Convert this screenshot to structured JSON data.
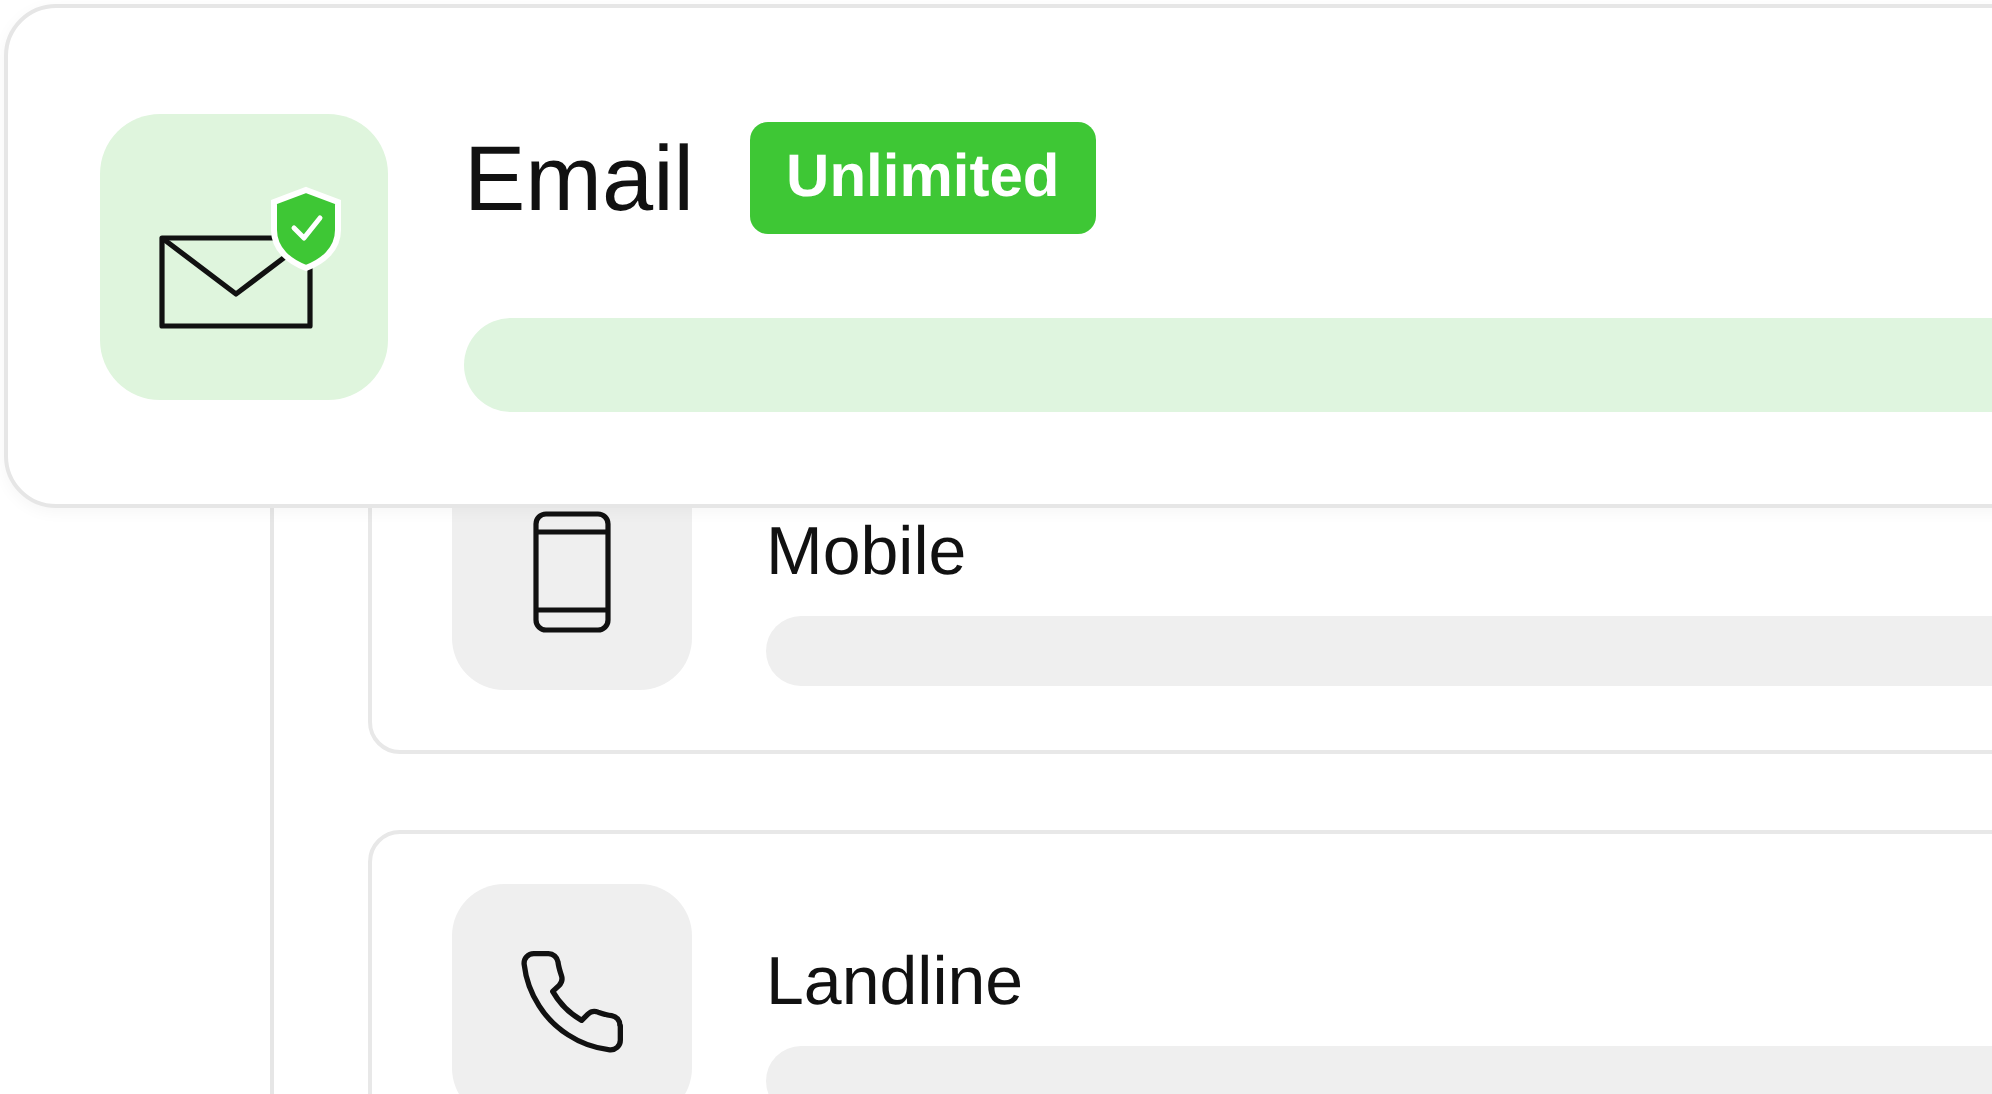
{
  "featured": {
    "title": "Email",
    "badge": "Unlimited"
  },
  "channels": [
    {
      "title": "Mobile",
      "kind": "mobile"
    },
    {
      "title": "Landline",
      "kind": "landline"
    }
  ]
}
